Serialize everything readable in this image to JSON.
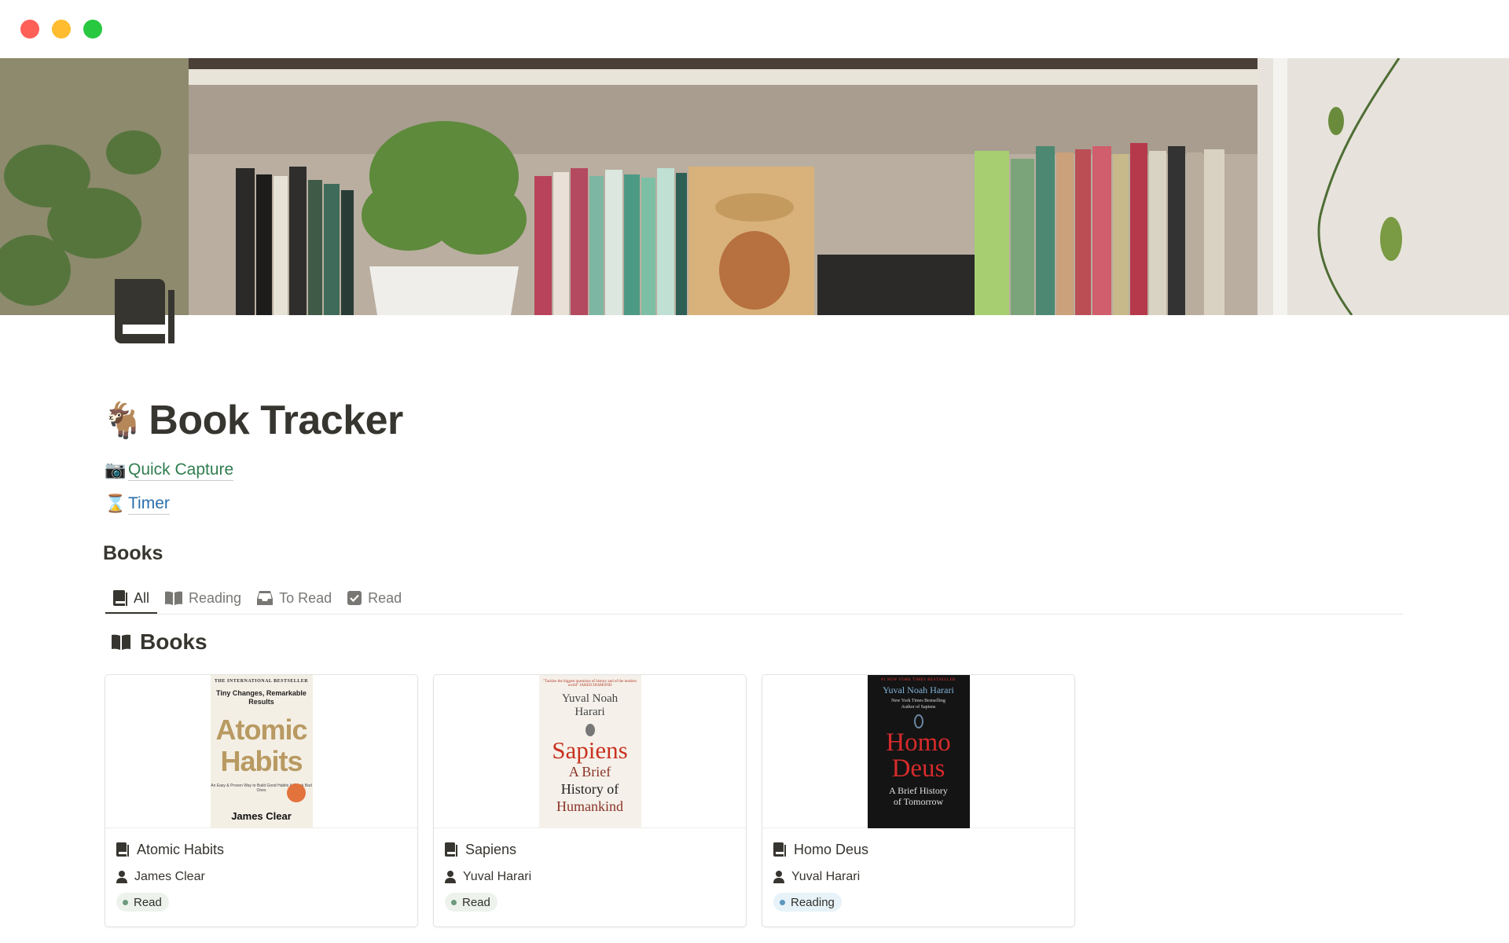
{
  "page": {
    "title": "Book Tracker",
    "title_emoji": "🐐"
  },
  "links": [
    {
      "emoji": "📷",
      "label": "Quick Capture"
    },
    {
      "emoji": "⌛",
      "label": "Timer"
    }
  ],
  "section": {
    "heading": "Books"
  },
  "tabs": [
    {
      "label": "All",
      "icon": "book-stack-icon",
      "active": true
    },
    {
      "label": "Reading",
      "icon": "open-book-icon",
      "active": false
    },
    {
      "label": "To Read",
      "icon": "inbox-tray-icon",
      "active": false
    },
    {
      "label": "Read",
      "icon": "checkbox-icon",
      "active": false
    }
  ],
  "database": {
    "title": "Books",
    "icon": "open-book-icon"
  },
  "cards": [
    {
      "name": "Atomic Habits",
      "author": "James Clear",
      "status": "Read",
      "cover": {
        "top_line": "THE INTERNATIONAL BESTSELLER",
        "subtitle": "Tiny Changes, Remarkable Results",
        "title_line1": "Atomic",
        "title_line2": "Habits",
        "tagline": "An Easy & Proven Way to Build Good Habits & Break Bad Ones",
        "author": "James Clear"
      }
    },
    {
      "name": "Sapiens",
      "author": "Yuval Harari",
      "status": "Read",
      "cover": {
        "quote": "\"Tackles the biggest questions of history and of the modern world\" JARED DIAMOND",
        "author_line1": "Yuval Noah",
        "author_line2": "Harari",
        "title": "Sapiens",
        "sub1": "A Brief",
        "sub2": "History of",
        "sub3": "Humankind"
      }
    },
    {
      "name": "Homo Deus",
      "author": "Yuval Harari",
      "status": "Reading",
      "cover": {
        "top_line": "#1 NEW YORK TIMES BESTSELLER",
        "author": "Yuval Noah Harari",
        "note1": "New York Times Bestselling",
        "note2": "Author of Sapiens",
        "title_line1": "Homo",
        "title_line2": "Deus",
        "sub1": "A Brief History",
        "sub2": "of Tomorrow"
      }
    }
  ],
  "colors": {
    "status_read": "#edf3ec",
    "status_reading": "#e7f3f8",
    "link_quick_capture": "#2f7d4f",
    "link_timer": "#2a6fae"
  }
}
